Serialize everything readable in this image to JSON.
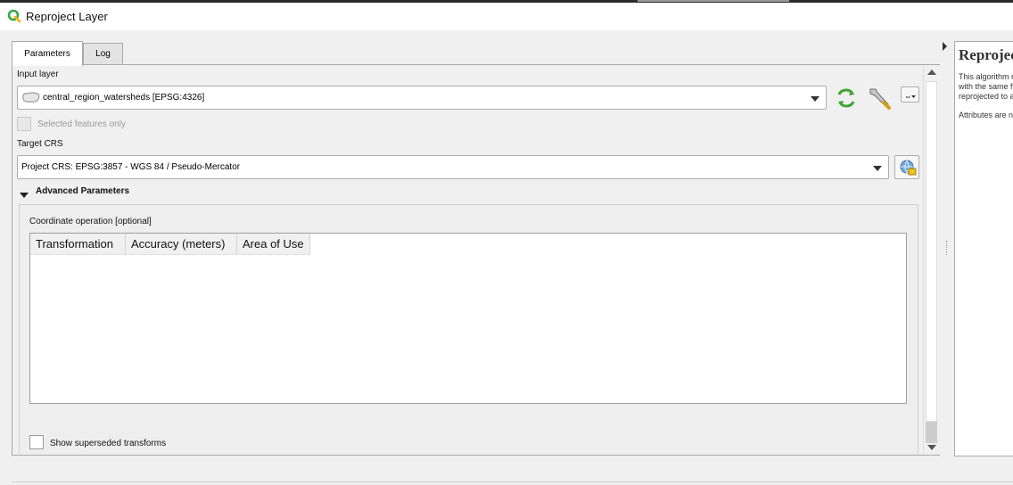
{
  "window": {
    "title": "Reproject Layer"
  },
  "tabs": [
    {
      "label": "Parameters",
      "active": true
    },
    {
      "label": "Log",
      "active": false
    }
  ],
  "form": {
    "input_layer": {
      "label": "Input layer",
      "value": "central_region_watersheds [EPSG:4326]"
    },
    "selected_only": {
      "label": "Selected features only",
      "checked": false,
      "enabled": false
    },
    "target_crs": {
      "label": "Target CRS",
      "value": "Project CRS: EPSG:3857 - WGS 84 / Pseudo-Mercator"
    },
    "advanced": {
      "label": "Advanced Parameters",
      "expanded": true,
      "coordinate_operation_label": "Coordinate operation [optional]",
      "table_headers": [
        "Transformation",
        "Accuracy (meters)",
        "Area of Use"
      ],
      "rows": [],
      "show_superseded": {
        "label": "Show superseded transforms",
        "checked": false
      }
    }
  },
  "help": {
    "title": "Reproject Layer",
    "text_lines": [
      "This algorithm reprojects a vector layer.",
      "with the same features as the input one, but with geometries",
      "reprojected to a new CRS.",
      "",
      "Attributes are not modified by this algorithm."
    ]
  },
  "colors": {
    "refresh_icon": "#3ca52f",
    "qgis_logo": "#3aa545"
  },
  "icons": {
    "app": "qgis-logo-icon",
    "polygon_layer": "polygon-layer-icon",
    "refresh": "iterate-refresh-icon",
    "settings": "wrench-icon",
    "more": "ellipsis-dropdown-icon",
    "crs": "globe-crs-icon"
  }
}
